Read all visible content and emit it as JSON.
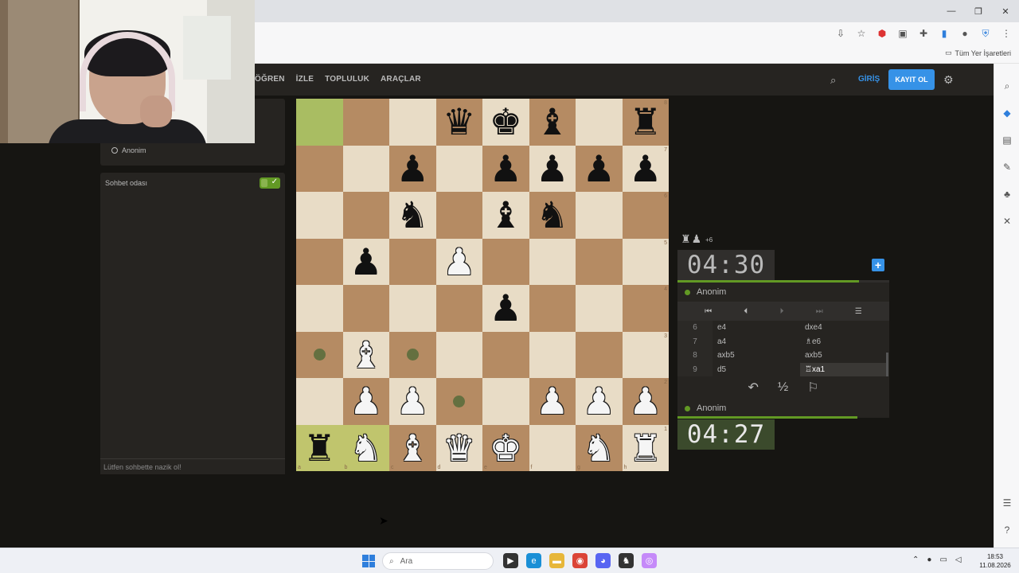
{
  "browser": {
    "bookmarks_label": "Tüm Yer İşaretleri",
    "window_controls": [
      "minimize-icon",
      "restore-icon",
      "close-icon"
    ]
  },
  "header": {
    "nav": [
      "ÖĞREN",
      "İZLE",
      "TOPLULUK",
      "ARAÇLAR"
    ],
    "login": "GİRİŞ",
    "signup": "KAYIT OL"
  },
  "left": {
    "player_name": "Anonim",
    "chat_title": "Sohbet odası",
    "chat_placeholder": "Lütfen sohbette nazik ol!"
  },
  "board": {
    "ranks": [
      "8",
      "7",
      "6",
      "5",
      "4",
      "3",
      "2",
      "1"
    ],
    "files": [
      "a",
      "b",
      "c",
      "d",
      "e",
      "f",
      "g",
      "h"
    ],
    "squares": [
      [
        "",
        "",
        "",
        "bq",
        "bk",
        "bb",
        "",
        "br"
      ],
      [
        "",
        "",
        "bp",
        "",
        "bp",
        "bp",
        "bp",
        "bp"
      ],
      [
        "",
        "",
        "bn",
        "",
        "bb",
        "bn",
        "",
        ""
      ],
      [
        "",
        "bp",
        "",
        "wp",
        "",
        "",
        "",
        ""
      ],
      [
        "",
        "",
        "",
        "",
        "bp",
        "",
        "",
        ""
      ],
      [
        "dot",
        "wb",
        "dot",
        "",
        "",
        "",
        "",
        ""
      ],
      [
        "",
        "wp",
        "wp",
        "dot",
        "",
        "wp",
        "wp",
        "wp"
      ],
      [
        "br",
        "wn",
        "wb",
        "wq",
        "wk",
        "",
        "wn",
        "wr"
      ]
    ],
    "highlights": [
      "a8",
      "a1",
      "b1"
    ]
  },
  "right": {
    "captured_pieces": [
      "♜",
      "♟"
    ],
    "captured_diff": "+6",
    "top_clock": "04:30",
    "top_player": "Anonim",
    "bottom_player": "Anonim",
    "bottom_clock": "04:27",
    "moves": [
      {
        "n": "6",
        "w": "e4",
        "b": "dxe4"
      },
      {
        "n": "7",
        "w": "a4",
        "b": "♗e6"
      },
      {
        "n": "8",
        "w": "axb5",
        "b": "axb5"
      },
      {
        "n": "9",
        "w": "d5",
        "b": "♖xa1"
      }
    ],
    "draw_label": "½"
  },
  "taskbar": {
    "search_placeholder": "Ara",
    "time": "18:53",
    "date": "11.08.2026"
  },
  "colors": {
    "accent": "#3692e7",
    "green": "#629924",
    "light_square": "#e8dcc6",
    "dark_square": "#b58b63"
  }
}
